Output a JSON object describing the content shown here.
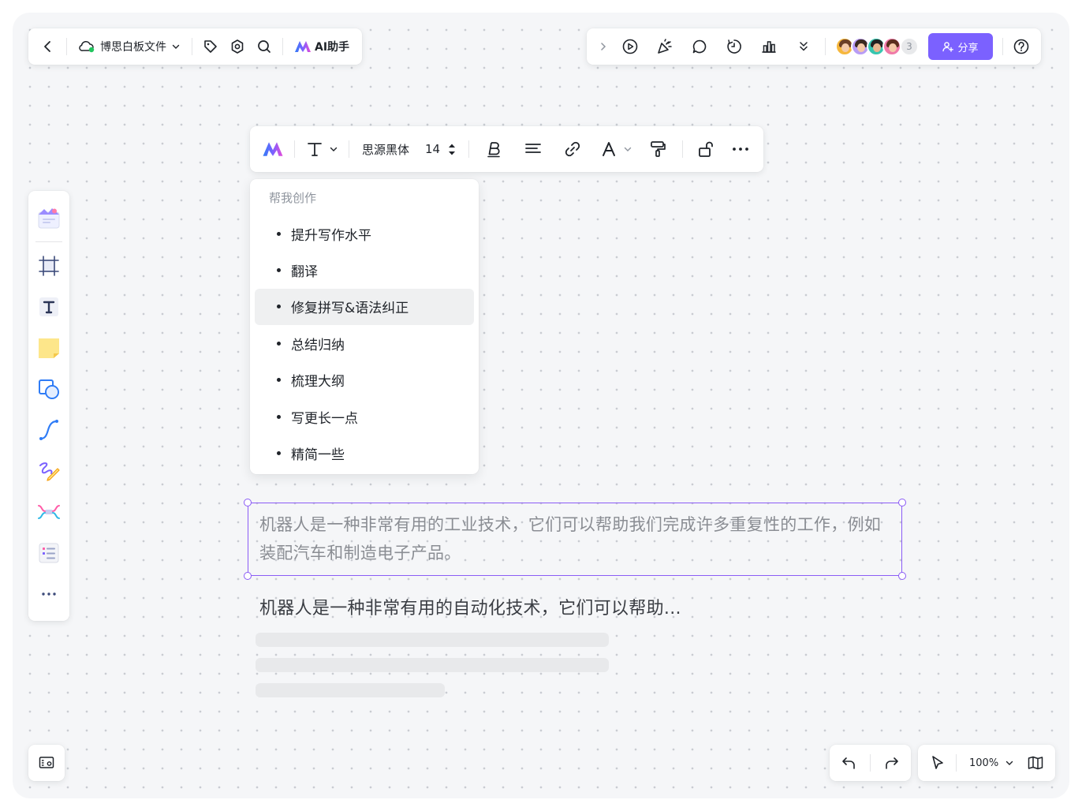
{
  "header": {
    "file_title": "博思白板文件",
    "ai_assistant_label": "AI助手"
  },
  "collaboration": {
    "extra_member_count": "3",
    "share_label": "分享"
  },
  "format_toolbar": {
    "font_name": "思源黑体",
    "font_size": "14"
  },
  "ai_menu": {
    "header": "帮我创作",
    "items": [
      {
        "label": "提升写作水平"
      },
      {
        "label": "翻译"
      },
      {
        "label": "修复拼写&语法纠正"
      },
      {
        "label": "总结归纳"
      },
      {
        "label": "梳理大纲"
      },
      {
        "label": "写更长一点"
      },
      {
        "label": "精简一些"
      }
    ]
  },
  "canvas": {
    "selected_text": "机器人是一种非常有用的工业技术，它们可以帮助我们完成许多重复性的工作，例如装配汽车和制造电子产品。",
    "generated_text": "机器人是一种非常有用的自动化技术，它们可以帮助..."
  },
  "footer": {
    "zoom": "100%"
  },
  "colors": {
    "accent": "#7b61ff",
    "selection": "#8b5cf6"
  }
}
